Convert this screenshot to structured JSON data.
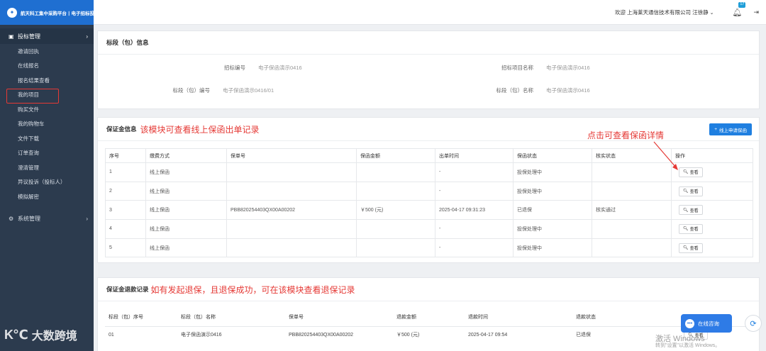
{
  "logo": {
    "text": "航天科工集中采购平台丨电子招标投标专区"
  },
  "sidebar": {
    "group1": {
      "label": "投标管理",
      "items": [
        "邀请回执",
        "在线报名",
        "报名结果查看",
        "我的项目",
        "购买文件",
        "我的购物车",
        "文件下载",
        "订单查询",
        "澄清管理",
        "异议投诉（投标人）",
        "模拟解密"
      ]
    },
    "group2": {
      "label": "系统管理"
    }
  },
  "header": {
    "welcome": "欢迎 上海莱天通信技术有限公司 汪徐静",
    "badge": "17"
  },
  "package_info": {
    "title": "标段（包）信息",
    "fields": [
      {
        "label": "招标编号",
        "value": "电子保函演示0416"
      },
      {
        "label": "招标项目名称",
        "value": "电子保函演示0416"
      },
      {
        "label": "标段（包）编号",
        "value": "电子保函演示0416/01"
      },
      {
        "label": "标段（包）名称",
        "value": "电子保函演示0416"
      }
    ]
  },
  "deposit": {
    "title": "保证金信息",
    "annotation": "该模块可查看线上保函出单记录",
    "add_button": "线上申请保函",
    "columns": [
      "序号",
      "缴费方式",
      "保单号",
      "保函金额",
      "出单时间",
      "保函状态",
      "核实状态",
      "操作"
    ],
    "rows": [
      [
        "1",
        "线上保函",
        "",
        "",
        "-",
        "投保处理中",
        ""
      ],
      [
        "2",
        "线上保函",
        "",
        "",
        "-",
        "投保处理中",
        ""
      ],
      [
        "3",
        "线上保函",
        "PBB820254403QX00A00202",
        "￥500 (元)",
        "2025-04-17 09:31:23",
        "已退保",
        "核实通过"
      ],
      [
        "4",
        "线上保函",
        "",
        "",
        "-",
        "投保处理中",
        ""
      ],
      [
        "5",
        "线上保函",
        "",
        "",
        "-",
        "投保处理中",
        ""
      ]
    ],
    "view_label": "查看"
  },
  "click_annotation": "点击可查看保函详情",
  "refund": {
    "title": "保证金退款记录",
    "annotation": "如有发起退保，且退保成功，可在该模块查看退保记录",
    "columns": [
      "标段（包）序号",
      "标段（包）名称",
      "保单号",
      "退款金额",
      "退款时间",
      "退款状态"
    ],
    "rows": [
      [
        "01",
        "电子保函演示0416",
        "PBB820254403QX00A00202",
        "￥500 (元)",
        "2025-04-17 09:54",
        "已退保"
      ]
    ],
    "view_label": "查看"
  },
  "chat": {
    "label": "在线咨询"
  },
  "watermark": {
    "text": "大数跨境",
    "mark": "K℃"
  },
  "windows_watermark": {
    "line1": "激活 Windows",
    "line2": "转到\"设置\"以激活 Windows。"
  },
  "colors": {
    "sidebar": "#2c3b4e",
    "primary": "#1f7fe0",
    "annotation": "#e53935"
  }
}
